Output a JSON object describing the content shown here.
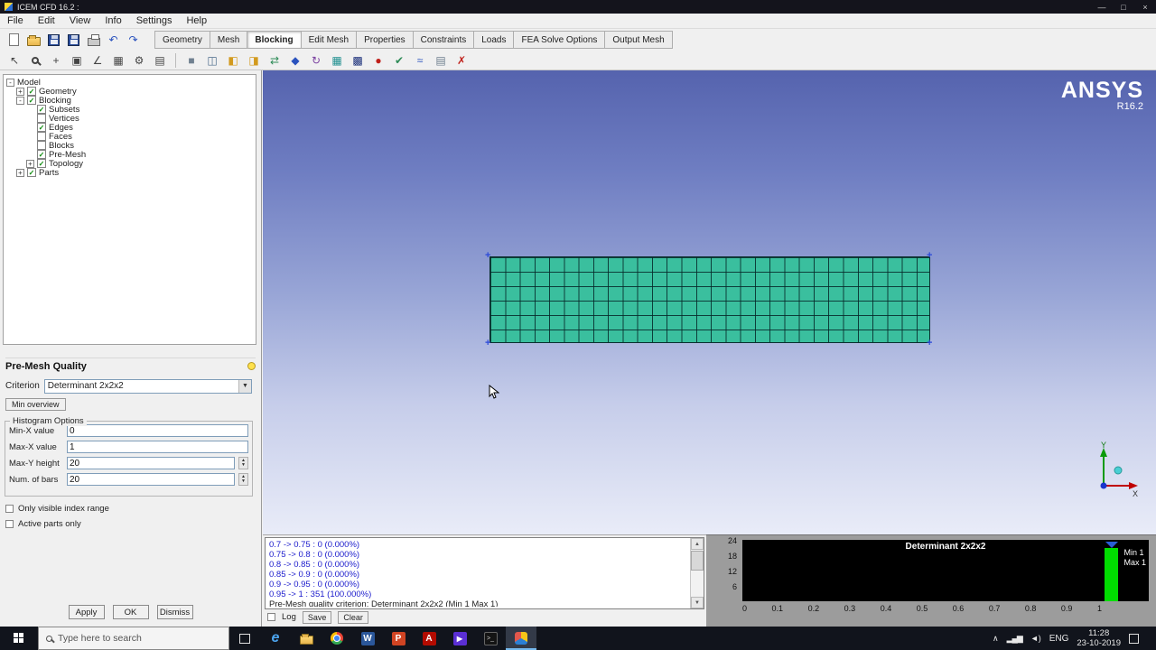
{
  "titlebar": {
    "title": "ICEM CFD 16.2 :",
    "minimize": "—",
    "maximize": "□",
    "close": "×"
  },
  "menubar": {
    "items": [
      "File",
      "Edit",
      "View",
      "Info",
      "Settings",
      "Help"
    ]
  },
  "tabs": {
    "items": [
      "Geometry",
      "Mesh",
      "Blocking",
      "Edit Mesh",
      "Properties",
      "Constraints",
      "Loads",
      "FEA Solve Options",
      "Output Mesh"
    ],
    "active": "Blocking"
  },
  "toolbar": {
    "undo_glyph": "↶",
    "redo_glyph": "↷",
    "view_icons": [
      {
        "name": "select-arrow-icon",
        "glyph": "↖"
      },
      {
        "name": "pan-icon",
        "glyph": "+"
      },
      {
        "name": "fit-view-icon",
        "glyph": "▣"
      },
      {
        "name": "measure-icon",
        "glyph": "∠"
      },
      {
        "name": "grid-icon",
        "glyph": "▦"
      },
      {
        "name": "gear-icon",
        "glyph": "⚙"
      },
      {
        "name": "layers-icon",
        "glyph": "▤"
      }
    ],
    "blocking_icons": [
      {
        "name": "create-block-icon",
        "glyph": "■"
      },
      {
        "name": "split-block-icon",
        "glyph": "◫"
      },
      {
        "name": "merge-vertices-icon",
        "glyph": "◧"
      },
      {
        "name": "edit-block-icon",
        "glyph": "◨"
      },
      {
        "name": "associate-icon",
        "glyph": "⇄"
      },
      {
        "name": "move-vertex-icon",
        "glyph": "◆"
      },
      {
        "name": "transform-block-icon",
        "glyph": "↻"
      },
      {
        "name": "mesh-params-icon",
        "glyph": "▦"
      },
      {
        "name": "premesh-icon",
        "glyph": "▩"
      },
      {
        "name": "quality-icon",
        "glyph": "●"
      },
      {
        "name": "check-icon",
        "glyph": "✔"
      },
      {
        "name": "smooth-icon",
        "glyph": "≈"
      },
      {
        "name": "scan-planes-icon",
        "glyph": "▤"
      },
      {
        "name": "delete-block-icon",
        "glyph": "✗"
      }
    ]
  },
  "tree": {
    "items": [
      {
        "label": "Model",
        "level": 0,
        "expander": "-"
      },
      {
        "label": "Geometry",
        "level": 1,
        "expander": "+",
        "checked": true
      },
      {
        "label": "Blocking",
        "level": 1,
        "expander": "-",
        "checked": true
      },
      {
        "label": "Subsets",
        "level": 2,
        "checked": true
      },
      {
        "label": "Vertices",
        "level": 2,
        "checked": false
      },
      {
        "label": "Edges",
        "level": 2,
        "checked": true
      },
      {
        "label": "Faces",
        "level": 2,
        "checked": false
      },
      {
        "label": "Blocks",
        "level": 2,
        "checked": false
      },
      {
        "label": "Pre-Mesh",
        "level": 2,
        "checked": true
      },
      {
        "label": "Topology",
        "level": 2,
        "expander": "+",
        "checked": true
      },
      {
        "label": "Parts",
        "level": 1,
        "expander": "+",
        "checked": true
      }
    ]
  },
  "quality_panel": {
    "title": "Pre-Mesh Quality",
    "criterion_label": "Criterion",
    "criterion_value": "Determinant 2x2x2",
    "min_overview_label": "Min overview",
    "group_label": "Histogram Options",
    "fields": [
      {
        "label": "Min-X value",
        "value": "0"
      },
      {
        "label": "Max-X value",
        "value": "1"
      },
      {
        "label": "Max-Y height",
        "value": "20"
      },
      {
        "label": "Num. of bars",
        "value": "20"
      }
    ],
    "checkboxes": [
      {
        "label": "Only visible index range",
        "checked": false
      },
      {
        "label": "Active parts only",
        "checked": false
      }
    ],
    "buttons": [
      "Apply",
      "OK",
      "Dismiss"
    ]
  },
  "viewport": {
    "brand": "ANSYS",
    "version": "R16.2",
    "triad": {
      "x_label": "X",
      "y_label": "Y"
    },
    "mesh": {
      "rows": 6,
      "cols": 30,
      "fill_color": "#3abf9e"
    }
  },
  "log": {
    "lines": [
      "0.7 -> 0.75 : 0 (0.000%)",
      "0.75 -> 0.8 : 0 (0.000%)",
      "0.8 -> 0.85 : 0 (0.000%)",
      "0.85 -> 0.9 : 0 (0.000%)",
      "0.9 -> 0.95 : 0 (0.000%)",
      "0.95 -> 1 : 351 (100.000%)",
      "Pre-Mesh quality criterion: Determinant 2x2x2 (Min 1 Max 1)"
    ],
    "log_label": "Log",
    "save_label": "Save",
    "clear_label": "Clear"
  },
  "chart_data": {
    "type": "bar",
    "title": "Determinant 2x2x2",
    "xlabel": "",
    "ylabel": "",
    "xlim": [
      0,
      1
    ],
    "ylim": [
      0,
      24
    ],
    "x_tick_labels": [
      "0",
      "0.1",
      "0.2",
      "0.3",
      "0.4",
      "0.5",
      "0.6",
      "0.7",
      "0.8",
      "0.9",
      "1"
    ],
    "y_tick_labels": [
      "24",
      "18",
      "12",
      "6"
    ],
    "bins": [
      {
        "range": "0.7 -> 0.75",
        "count": 0,
        "pct": "0.000%"
      },
      {
        "range": "0.75 -> 0.8",
        "count": 0,
        "pct": "0.000%"
      },
      {
        "range": "0.8 -> 0.85",
        "count": 0,
        "pct": "0.000%"
      },
      {
        "range": "0.85 -> 0.9",
        "count": 0,
        "pct": "0.000%"
      },
      {
        "range": "0.9 -> 0.95",
        "count": 0,
        "pct": "0.000%"
      },
      {
        "range": "0.95 -> 1",
        "count": 351,
        "pct": "100.000%"
      }
    ],
    "bar_color": "#00dd00",
    "plot_background": "#000000",
    "grid": false,
    "legend": [
      "Min 1",
      "Max 1"
    ],
    "legend_position": "right"
  },
  "taskbar": {
    "search": {
      "placeholder": "Type here to search"
    },
    "apps": [
      {
        "name": "edge-icon",
        "letter": "e"
      },
      {
        "name": "file-explorer-icon"
      },
      {
        "name": "chrome-icon"
      },
      {
        "name": "word-icon",
        "letter": "W"
      },
      {
        "name": "powerpoint-icon",
        "letter": "P"
      },
      {
        "name": "acrobat-icon",
        "letter": "A"
      },
      {
        "name": "media-player-icon",
        "letter": "▶"
      },
      {
        "name": "terminal-icon",
        "letter": ">_"
      },
      {
        "name": "icem-cfd-icon"
      }
    ],
    "tray": {
      "chevron": "∧",
      "network": "▂▄▆",
      "volume": "◄)",
      "lang": "ENG",
      "time": "11:28",
      "date": "23-10-2019"
    }
  },
  "colors": {
    "mesh_fill": "#3abf9e",
    "viewport_gradient_top": "#5563ae",
    "viewport_gradient_bottom": "#e9ecf8",
    "histogram_bar": "#00dd00",
    "taskbar_bg": "#11141c"
  }
}
